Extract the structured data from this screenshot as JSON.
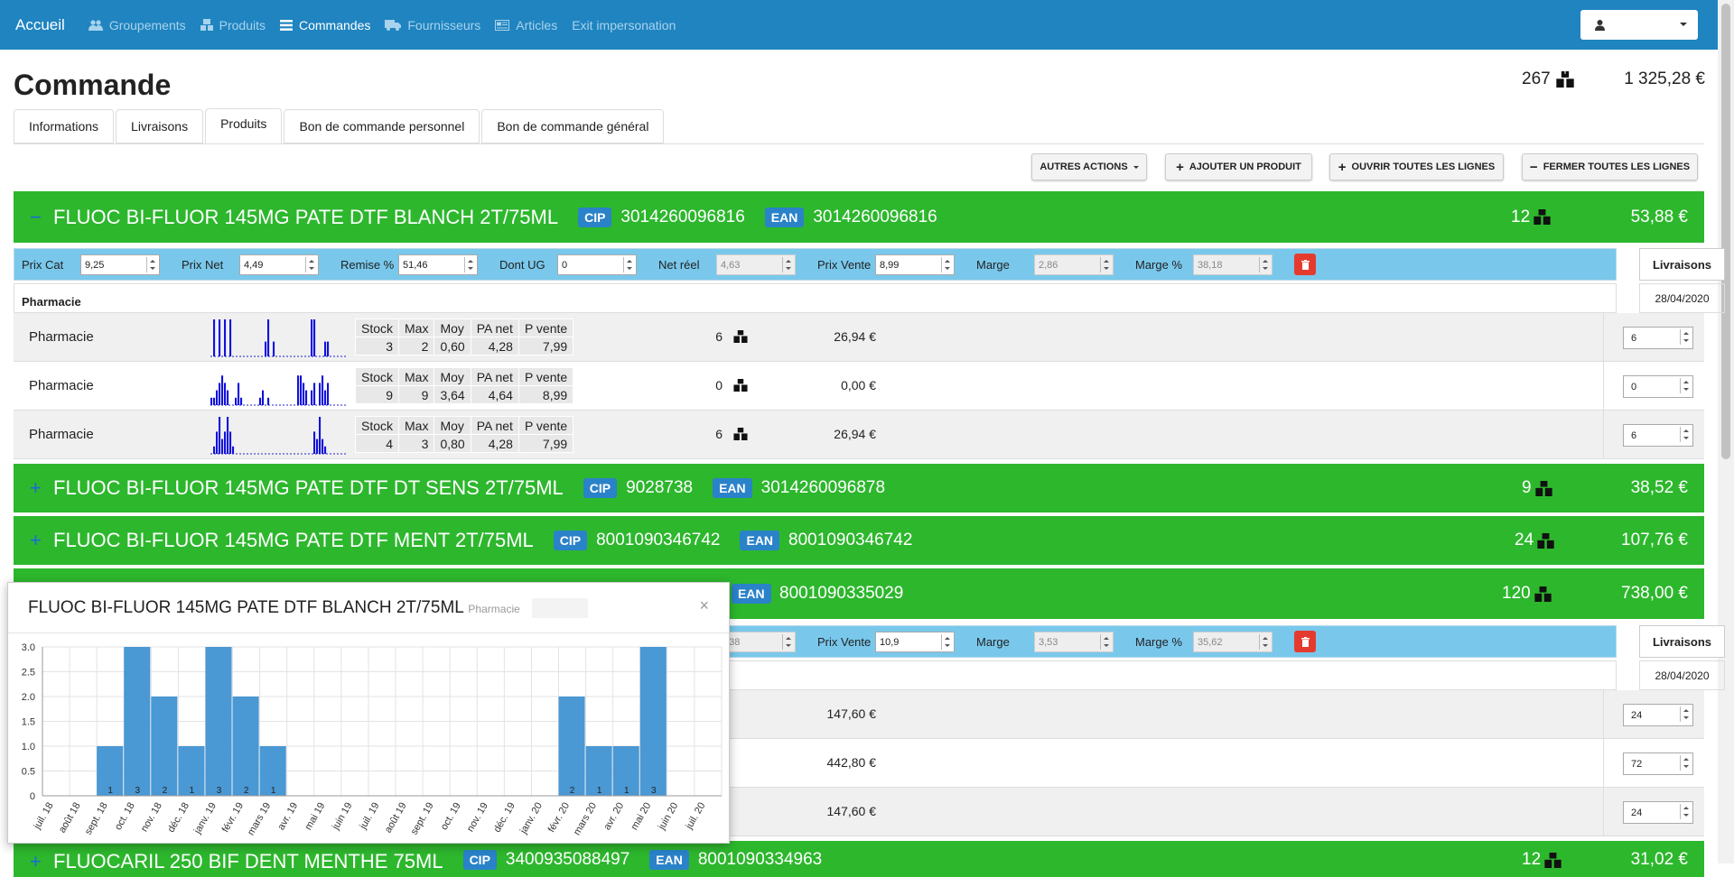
{
  "nav": {
    "brand": "Accueil",
    "items": [
      {
        "label": "Groupements",
        "icon": "users-icon",
        "active": false
      },
      {
        "label": "Produits",
        "icon": "boxes-icon",
        "active": false
      },
      {
        "label": "Commandes",
        "icon": "list-icon",
        "active": true
      },
      {
        "label": "Fournisseurs",
        "icon": "truck-icon",
        "active": false
      },
      {
        "label": "Articles",
        "icon": "newspaper-icon",
        "active": false
      },
      {
        "label": "Exit impersonation",
        "icon": "",
        "active": false
      }
    ],
    "user_icon": "user-icon"
  },
  "page": {
    "title": "Commande",
    "total_qty": "267",
    "total_amount": "1 325,28 €"
  },
  "tabs": [
    "Informations",
    "Livraisons",
    "Produits",
    "Bon de commande personnel",
    "Bon de commande général"
  ],
  "actions": {
    "autres": "AUTRES ACTIONS",
    "ajouter": "AJOUTER UN PRODUIT",
    "ouvrir": "OUVRIR TOUTES LES LIGNES",
    "fermer": "FERMER TOUTES LES LIGNES"
  },
  "labels": {
    "cip": "CIP",
    "ean": "EAN",
    "prix_cat": "Prix Cat",
    "prix_net": "Prix Net",
    "remise": "Remise %",
    "dont_ug": "Dont UG",
    "net_reel": "Net réel",
    "prix_vente": "Prix Vente",
    "marge": "Marge",
    "marge_pct": "Marge %",
    "livraisons": "Livraisons",
    "pharmacie_hdr": "Pharmacie",
    "delivery_date": "28/04/2020",
    "stat_headers": [
      "Stock",
      "Max",
      "Moy",
      "PA net",
      "P vente"
    ]
  },
  "products": [
    {
      "name": "FLUOC BI-FLUOR 145MG PATE DTF BLANCH 2T/75ML",
      "toggle": "−",
      "cip": "3014260096816",
      "ean": "3014260096816",
      "qty": "12",
      "total": "53,88 €"
    },
    {
      "name": "FLUOC BI-FLUOR 145MG PATE DTF DT SENS 2T/75ML",
      "toggle": "+",
      "cip": "9028738",
      "ean": "3014260096878",
      "qty": "9",
      "total": "38,52 €"
    },
    {
      "name": "FLUOC BI-FLUOR 145MG PATE DTF MENT 2T/75ML",
      "toggle": "+",
      "cip": "8001090346742",
      "ean": "8001090346742",
      "qty": "24",
      "total": "107,76 €"
    },
    {
      "name": "",
      "toggle": "",
      "cip": "",
      "ean": "8001090335029",
      "qty": "120",
      "total": "738,00 €"
    },
    {
      "name": "FLUOCARIL 250 BIF DENT MENTHE 75ML",
      "toggle": "+",
      "cip": "3400935088497",
      "ean": "8001090334963",
      "qty": "12",
      "total": "31,02 €"
    }
  ],
  "price_row1": {
    "prix_cat": "9,25",
    "prix_net": "4,49",
    "remise": "51,46",
    "dont_ug": "0",
    "net_reel": "4,63",
    "prix_vente": "8,99",
    "marge": "2,86",
    "marge_pct": "38,18"
  },
  "price_row2": {
    "net_reel": "5,38",
    "prix_vente": "10,9",
    "marge": "3,53",
    "marge_pct": "35,62"
  },
  "rows1": [
    {
      "label": "Pharmacie",
      "stats": [
        "3",
        "2",
        "0,60",
        "4,28",
        "7,99"
      ],
      "qty": "6",
      "amount": "26,94 €",
      "input": "6",
      "spark": [
        0,
        5,
        0,
        5,
        0,
        5,
        0,
        5,
        0,
        0,
        0,
        0,
        0,
        0,
        0,
        0,
        0,
        0,
        0,
        0,
        2,
        5,
        0,
        2,
        0,
        0,
        0,
        0,
        0,
        0,
        0,
        0,
        0,
        0,
        0,
        0,
        0,
        5,
        5,
        0,
        0,
        0,
        2,
        2,
        0,
        0,
        0,
        0,
        0,
        0
      ]
    },
    {
      "label": "Pharmacie",
      "stats": [
        "9",
        "9",
        "3,64",
        "4,64",
        "8,99"
      ],
      "qty": "0",
      "amount": "0,00 €",
      "input": "0",
      "spark": [
        1,
        1,
        2,
        3,
        4,
        3,
        2,
        0,
        0,
        1,
        3,
        1,
        0,
        0,
        0,
        0,
        0,
        0,
        1,
        2,
        0,
        1,
        0,
        0,
        0,
        0,
        0,
        0,
        0,
        0,
        0,
        0,
        4,
        4,
        3,
        2,
        0,
        2,
        3,
        0,
        3,
        4,
        2,
        3,
        0,
        0,
        0,
        0,
        0,
        0
      ]
    },
    {
      "label": "Pharmacie",
      "stats": [
        "4",
        "3",
        "0,80",
        "4,28",
        "7,99"
      ],
      "qty": "6",
      "amount": "26,94 €",
      "input": "6",
      "spark": [
        0,
        1,
        3,
        5,
        2,
        3,
        5,
        3,
        1,
        0,
        0,
        0,
        0,
        0,
        0,
        0,
        0,
        0,
        0,
        0,
        0,
        0,
        0,
        0,
        0,
        0,
        0,
        0,
        0,
        0,
        0,
        0,
        0,
        0,
        0,
        0,
        0,
        0,
        3,
        2,
        5,
        2,
        1,
        0,
        0,
        0,
        0,
        0,
        0,
        0
      ]
    }
  ],
  "rows2": [
    {
      "amount": "147,60 €",
      "input": "24"
    },
    {
      "amount": "442,80 €",
      "input": "72"
    },
    {
      "amount": "147,60 €",
      "input": "24"
    }
  ],
  "popup": {
    "title": "FLUOC BI-FLUOR 145MG PATE DTF BLANCH 2T/75ML",
    "subtitle": "Pharmacie",
    "close": "×"
  },
  "chart_data": {
    "type": "bar",
    "title": "FLUOC BI-FLUOR 145MG PATE DTF BLANCH 2T/75ML",
    "categories": [
      "juil. 18",
      "août 18",
      "sept. 18",
      "oct. 18",
      "nov. 18",
      "déc. 18",
      "janv. 19",
      "févr. 19",
      "mars 19",
      "avr. 19",
      "mai 19",
      "juin 19",
      "juil. 19",
      "août 19",
      "sept. 19",
      "oct. 19",
      "nov. 19",
      "déc. 19",
      "janv. 20",
      "févr. 20",
      "mars 20",
      "avr. 20",
      "mai 20",
      "juin 20",
      "juil. 20"
    ],
    "values": [
      0,
      0,
      1,
      3,
      2,
      1,
      3,
      2,
      1,
      0,
      0,
      0,
      0,
      0,
      0,
      0,
      0,
      0,
      0,
      2,
      1,
      1,
      3,
      0,
      0
    ],
    "ylim": [
      0,
      3
    ],
    "yticks": [
      "0",
      "0.5",
      "1.0",
      "1.5",
      "2.0",
      "2.5",
      "3.0"
    ],
    "grid": true,
    "bar_color": "#4a98d4"
  }
}
